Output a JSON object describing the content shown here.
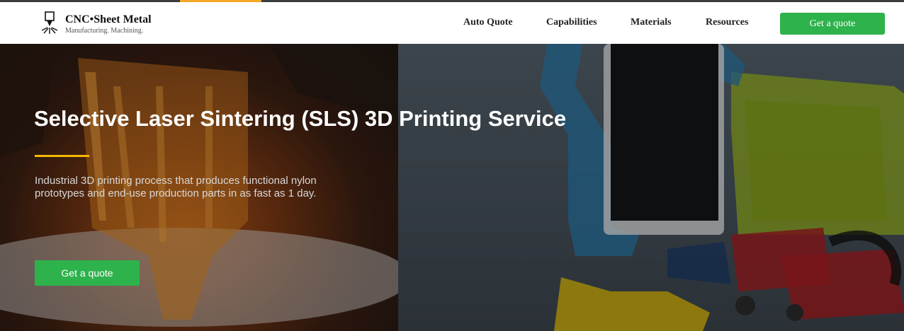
{
  "brand": {
    "name": "CNC•Sheet Metal",
    "tagline": "Manufacturing. Machining."
  },
  "nav": {
    "items": [
      {
        "label": "Auto Quote"
      },
      {
        "label": "Capabilities",
        "active": true
      },
      {
        "label": "Materials"
      },
      {
        "label": "Resources"
      }
    ],
    "cta_label": "Get a quote"
  },
  "hero": {
    "title": "Selective Laser Sintering (SLS) 3D Printing Service",
    "subtitle": "Industrial 3D printing process that produces functional nylon prototypes and end-use production parts in as fast as 1 day.",
    "cta_label": "Get a quote"
  },
  "colors": {
    "accent_green": "#2eb24c",
    "accent_orange": "#f5a623",
    "underline_yellow": "#f5b800"
  }
}
